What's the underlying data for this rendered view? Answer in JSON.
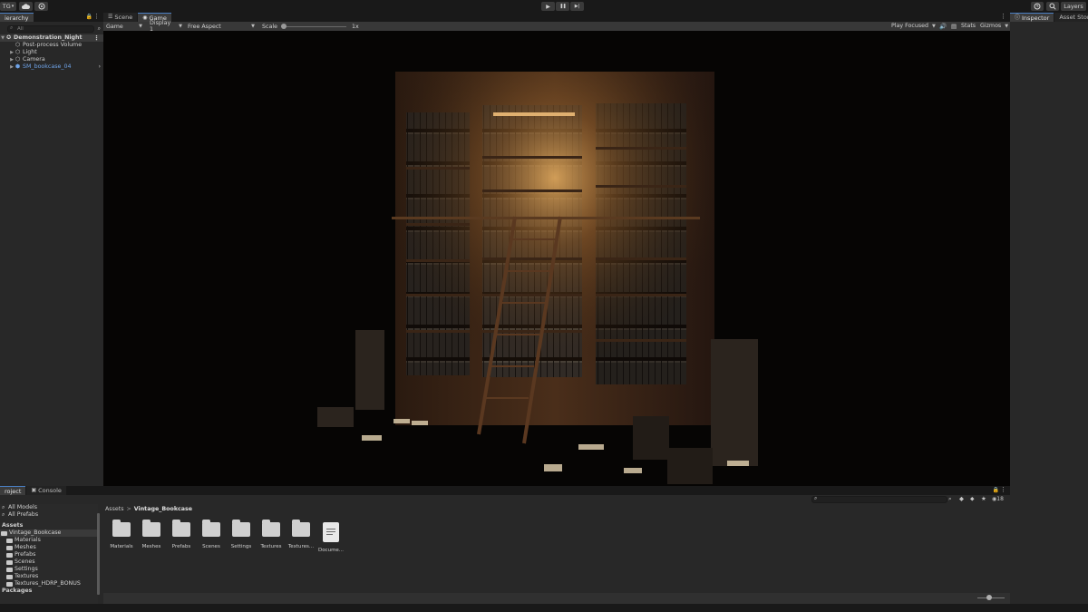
{
  "toolbar": {
    "account_label": "TG",
    "account_caret": "▾",
    "cloud_icon": "cloud-icon",
    "collab_icon": "collab-icon",
    "play_icon": "▶",
    "pause_icon": "❚❚",
    "step_icon": "▶|",
    "history_icon": "history-icon",
    "search_icon": "search-icon",
    "layers_label": "Layers"
  },
  "hierarchy": {
    "tab_label": "ierarchy",
    "search_placeholder": "All",
    "scene": "Demonstration_Night",
    "items": [
      {
        "label": "Post-process Volume",
        "color": "#cfcfcf"
      },
      {
        "label": "Light",
        "color": "#cfcfcf"
      },
      {
        "label": "Camera",
        "color": "#cfcfcf"
      },
      {
        "label": "SM_bookcase_04",
        "color": "#6fa3e8"
      }
    ]
  },
  "game_view": {
    "tabs": [
      {
        "label": "Scene",
        "active": false
      },
      {
        "label": "Game",
        "active": true
      }
    ],
    "mode": "Game",
    "display": "Display 1",
    "aspect": "Free Aspect",
    "scale_label": "Scale",
    "scale_value": "1x",
    "play_focused": "Play Focused",
    "stats_label": "Stats",
    "gizmos_label": "Gizmos"
  },
  "inspector": {
    "tabs": [
      {
        "label": "Inspector",
        "active": true
      },
      {
        "label": "Asset Store V",
        "active": false
      }
    ]
  },
  "project": {
    "tabs": [
      {
        "label": "roject",
        "active": true
      },
      {
        "label": "Console",
        "active": false
      }
    ],
    "favorites": [
      "All Models",
      "All Prefabs"
    ],
    "assets_header": "Assets",
    "tree": [
      {
        "label": "Vintage_Bookcase",
        "selected": true,
        "indent": 0
      },
      {
        "label": "Materials",
        "selected": false,
        "indent": 1
      },
      {
        "label": "Meshes",
        "selected": false,
        "indent": 1
      },
      {
        "label": "Prefabs",
        "selected": false,
        "indent": 1
      },
      {
        "label": "Scenes",
        "selected": false,
        "indent": 1
      },
      {
        "label": "Settings",
        "selected": false,
        "indent": 1
      },
      {
        "label": "Textures",
        "selected": false,
        "indent": 1
      },
      {
        "label": "Textures_HDRP_BONUS",
        "selected": false,
        "indent": 1
      }
    ],
    "packages_header": "Packages",
    "breadcrumb": [
      "Assets",
      "Vintage_Bookcase"
    ],
    "breadcrumb_sep": ">",
    "hidden_count": "18",
    "assets": [
      {
        "label": "Materials",
        "kind": "folder"
      },
      {
        "label": "Meshes",
        "kind": "folder"
      },
      {
        "label": "Prefabs",
        "kind": "folder"
      },
      {
        "label": "Scenes",
        "kind": "folder"
      },
      {
        "label": "Settings",
        "kind": "folder"
      },
      {
        "label": "Textures",
        "kind": "folder"
      },
      {
        "label": "Textures...",
        "kind": "folder"
      },
      {
        "label": "Docume...",
        "kind": "document"
      }
    ]
  }
}
